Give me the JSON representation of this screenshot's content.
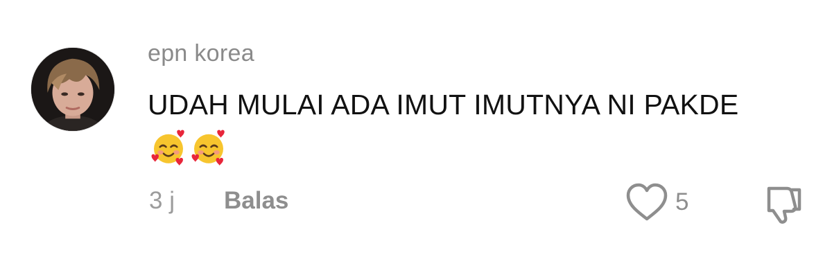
{
  "comment": {
    "username": "epn korea",
    "text": "UDAH MULAI ADA IMUT IMUTNYA NI PAKDE",
    "emojis": [
      "smiling-face-with-hearts",
      "smiling-face-with-hearts"
    ],
    "time": "3 j",
    "reply_label": "Balas",
    "like_count": "5",
    "icons": {
      "like": "heart-outline-icon",
      "dislike": "thumbs-down-outline-icon"
    },
    "colors": {
      "username": "#8a8a8a",
      "text": "#111111",
      "meta": "#9c9c9c",
      "icon_stroke": "#8e8e8e"
    }
  }
}
